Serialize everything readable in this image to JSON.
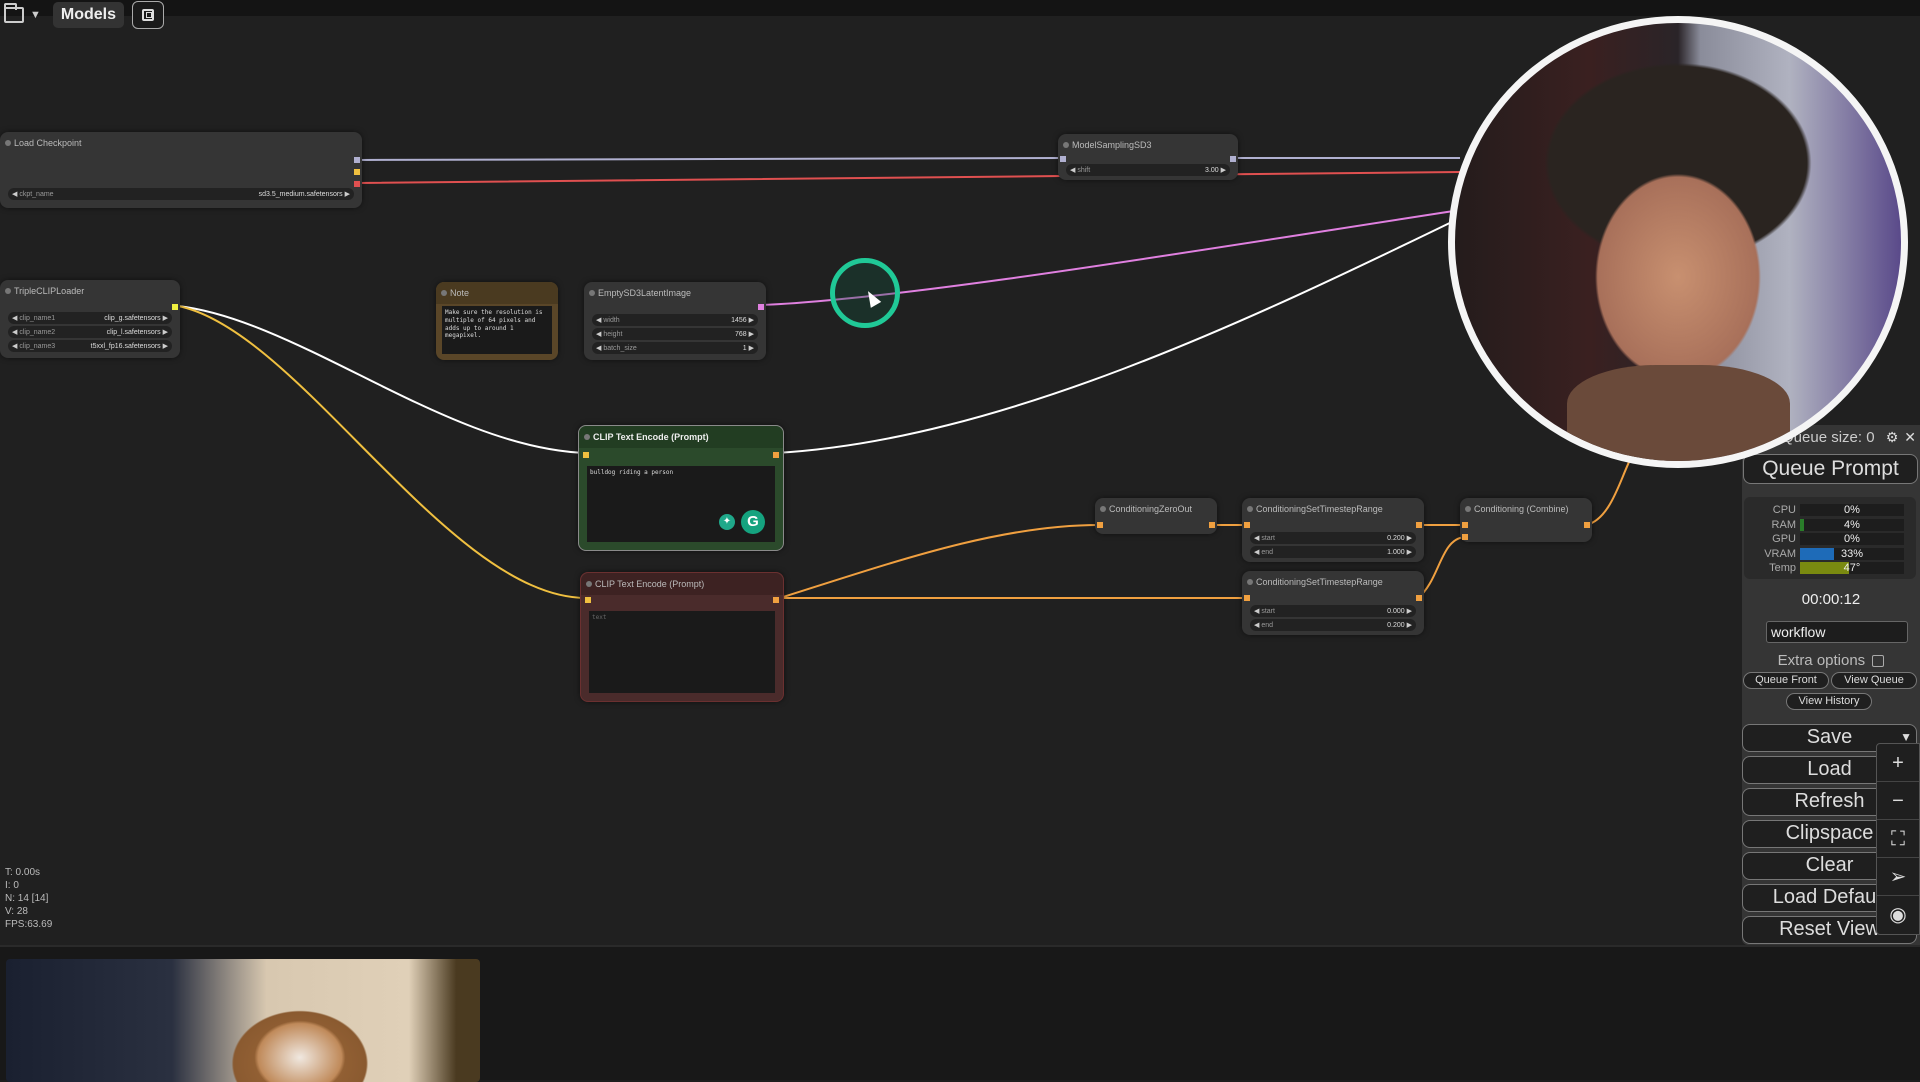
{
  "topbar": {
    "folder_icon": "folder-icon",
    "dropdown_icon": "chevron-down-icon",
    "models_label": "Models",
    "save_icon": "save-icon"
  },
  "nodes": {
    "load_checkpoint": {
      "title": "Load Checkpoint",
      "widgets": [
        {
          "label": "ckpt_name",
          "value": "sd3.5_medium.safetensors"
        }
      ]
    },
    "model_sampling": {
      "title": "ModelSamplingSD3",
      "widgets": [
        {
          "label": "shift",
          "value": "3.00"
        }
      ]
    },
    "triple_clip": {
      "title": "TripleCLIPLoader",
      "widgets": [
        {
          "label": "clip_name1",
          "value": "clip_g.safetensors"
        },
        {
          "label": "clip_name2",
          "value": "clip_l.safetensors"
        },
        {
          "label": "clip_name3",
          "value": "t5xxl_fp16.safetensors"
        }
      ]
    },
    "note": {
      "title": "Note",
      "text": "Make sure the resolution is multiple of 64 pixels and adds up to around 1 megapixel."
    },
    "empty_latent": {
      "title": "EmptySD3LatentImage",
      "widgets": [
        {
          "label": "width",
          "value": "1456"
        },
        {
          "label": "height",
          "value": "768"
        },
        {
          "label": "batch_size",
          "value": "1"
        }
      ]
    },
    "clip_positive": {
      "title": "CLIP Text Encode (Prompt)",
      "text": "bulldog riding a person"
    },
    "clip_negative": {
      "title": "CLIP Text Encode (Prompt)",
      "placeholder": "text"
    },
    "cond_zero_out": {
      "title": "ConditioningZeroOut"
    },
    "cond_range_1": {
      "title": "ConditioningSetTimestepRange",
      "widgets": [
        {
          "label": "start",
          "value": "0.200"
        },
        {
          "label": "end",
          "value": "1.000"
        }
      ]
    },
    "cond_range_2": {
      "title": "ConditioningSetTimestepRange",
      "widgets": [
        {
          "label": "start",
          "value": "0.000"
        },
        {
          "label": "end",
          "value": "0.200"
        }
      ]
    },
    "cond_combine": {
      "title": "Conditioning (Combine)"
    }
  },
  "stats": {
    "t": "T: 0.00s",
    "i": "I: 0",
    "n": "N: 14 [14]",
    "v": "V: 28",
    "fps": "FPS:63.69"
  },
  "sidemenu": {
    "queue_size": "Queue size: 0",
    "queue_prompt": "Queue Prompt",
    "monitor": [
      {
        "label": "CPU",
        "value": "0%",
        "fraction": 0.0,
        "color": "#2a7d2a"
      },
      {
        "label": "RAM",
        "value": "4%",
        "fraction": 0.04,
        "color": "#2a7d2a"
      },
      {
        "label": "GPU",
        "value": "0%",
        "fraction": 0.0,
        "color": "#2a7d2a"
      },
      {
        "label": "VRAM",
        "value": "33%",
        "fraction": 0.33,
        "color": "#1e6bb8"
      },
      {
        "label": "Temp",
        "value": "47°",
        "fraction": 0.47,
        "color": "#7a8a10"
      }
    ],
    "timer": "00:00:12",
    "workflow_name": "workflow",
    "extra_options": "Extra options",
    "queue_front": "Queue Front",
    "view_queue": "View Queue",
    "view_history": "View History",
    "buttons": [
      "Save",
      "Load",
      "Refresh",
      "Clipspace",
      "Clear",
      "Load Default",
      "Reset View"
    ]
  },
  "zoom_tools": [
    "+",
    "−",
    "⛶",
    "➢",
    "◉"
  ],
  "colors": {
    "accent_ring": "#20c997",
    "link_model": "#b0b0d0",
    "link_vae": "#e05050",
    "link_latent": "#e080e0",
    "link_clip": "#f0c040",
    "link_conditioning": "#f0a040"
  }
}
